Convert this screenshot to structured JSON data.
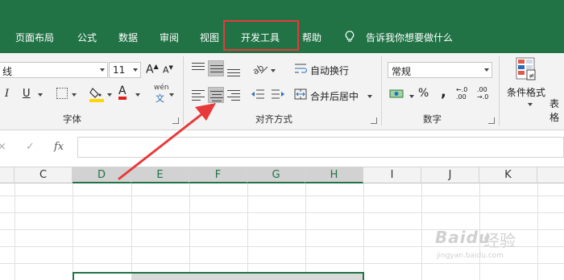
{
  "ribbon_tabs": {
    "items": [
      "页面布局",
      "公式",
      "数据",
      "审阅",
      "视图",
      "开发工具",
      "帮助"
    ],
    "highlighted": "开发工具",
    "tell_me": "告诉我你想要做什么",
    "highlight_color": "#e8393a",
    "tab_bg_color": "#217346"
  },
  "font_group": {
    "label": "字体",
    "font_name": "线",
    "font_size": "11",
    "grow_font": "A",
    "shrink_font": "A",
    "italic": "I",
    "underline": "U",
    "font_color_letter": "A",
    "phonetic_top": "wén",
    "phonetic_bottom": "文",
    "highlight_color": "#ffd700",
    "font_color": "#e02020"
  },
  "alignment_group": {
    "label": "对齐方式",
    "wrap_text": "自动换行",
    "merge_center": "合并后居中",
    "pressed": [
      "middle-align",
      "center-align"
    ]
  },
  "number_group": {
    "label": "数字",
    "format": "常规",
    "percent": "%",
    "comma": ",",
    "inc_decimal": "←.0 .00",
    "dec_decimal": ".00 →.0"
  },
  "styles_group": {
    "conditional_formatting": "条件格式",
    "table_format": "表格"
  },
  "formula_bar": {
    "cancel_icon": "×",
    "enter_icon": "✓",
    "fx_label": "fx",
    "value": ""
  },
  "columns": [
    "C",
    "D",
    "E",
    "F",
    "G",
    "H",
    "I",
    "J",
    "K"
  ],
  "selected_columns": [
    "D",
    "E",
    "F",
    "G",
    "H"
  ],
  "annotation": {
    "arrow_color": "#e8393a",
    "points_to": "center-align"
  },
  "watermark": {
    "brand": "Bai",
    "paw": "du",
    "sub": "经验",
    "url": "jingyan.baidu.com"
  }
}
